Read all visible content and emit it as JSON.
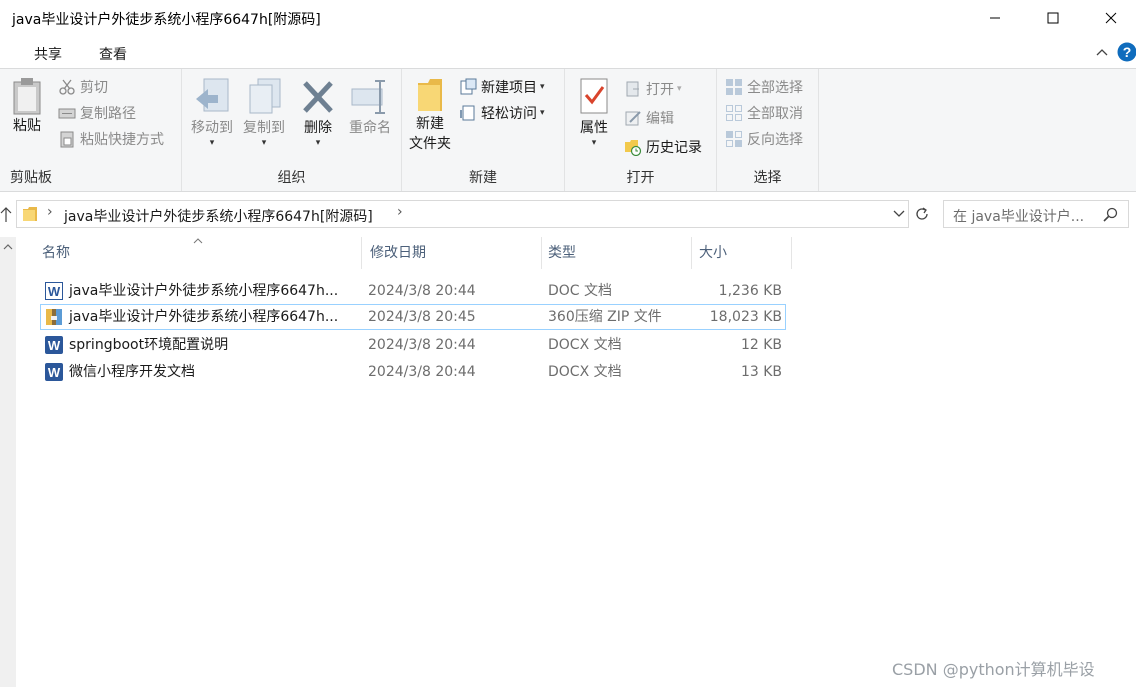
{
  "window": {
    "title": "java毕业设计户外徒步系统小程序6647h[附源码]"
  },
  "tabs": {
    "share": "共享",
    "view": "查看"
  },
  "ribbon": {
    "clipboard": {
      "label": "剪贴板",
      "paste": "粘贴",
      "cut": "剪切",
      "copy_path": "复制路径",
      "paste_shortcut": "粘贴快捷方式"
    },
    "organize": {
      "label": "组织",
      "move_to": "移动到",
      "copy_to": "复制到",
      "delete": "删除",
      "rename": "重命名"
    },
    "new": {
      "label": "新建",
      "new_folder_line1": "新建",
      "new_folder_line2": "文件夹",
      "new_item": "新建项目",
      "easy_access": "轻松访问"
    },
    "open": {
      "label": "打开",
      "properties": "属性",
      "open": "打开",
      "edit": "编辑",
      "history": "历史记录"
    },
    "select": {
      "label": "选择",
      "select_all": "全部选择",
      "select_none": "全部取消",
      "invert": "反向选择"
    }
  },
  "address": {
    "path": "java毕业设计户外徒步系统小程序6647h[附源码]",
    "search_placeholder": "在 java毕业设计户..."
  },
  "columns": {
    "name": "名称",
    "modified": "修改日期",
    "type": "类型",
    "size": "大小"
  },
  "files": [
    {
      "name": "java毕业设计户外徒步系统小程序6647h...",
      "modified": "2024/3/8 20:44",
      "type": "DOC 文档",
      "size": "1,236 KB",
      "icon": "word-doc-icon"
    },
    {
      "name": "java毕业设计户外徒步系统小程序6647h...",
      "modified": "2024/3/8 20:45",
      "type": "360压缩 ZIP 文件",
      "size": "18,023 KB",
      "icon": "zip-archive-icon"
    },
    {
      "name": "springboot环境配置说明",
      "modified": "2024/3/8 20:44",
      "type": "DOCX 文档",
      "size": "12 KB",
      "icon": "word-docx-icon"
    },
    {
      "name": "微信小程序开发文档",
      "modified": "2024/3/8 20:44",
      "type": "DOCX 文档",
      "size": "13 KB",
      "icon": "word-docx-icon"
    }
  ],
  "watermark": "CSDN @python计算机毕设",
  "colors": {
    "ribbon_bg": "#f5f6f7",
    "header_text": "#4c607a",
    "selection_border": "#99d1ff",
    "word_blue": "#2b579a",
    "help_blue": "#0f6cbd"
  }
}
